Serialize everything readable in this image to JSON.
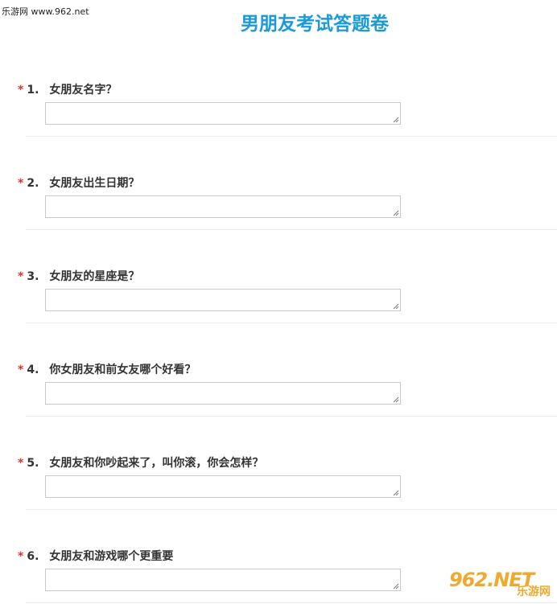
{
  "watermark": {
    "text": "乐游网 www.962.net"
  },
  "page": {
    "title": "男朋友考试答题卷"
  },
  "questions": [
    {
      "required": "*",
      "number": "1.",
      "text": "女朋友名字？",
      "answer": ""
    },
    {
      "required": "*",
      "number": "2.",
      "text": "女朋友出生日期？",
      "answer": ""
    },
    {
      "required": "*",
      "number": "3.",
      "text": "女朋友的星座是？",
      "answer": ""
    },
    {
      "required": "*",
      "number": "4.",
      "text": "你女朋友和前女友哪个好看？",
      "answer": ""
    },
    {
      "required": "*",
      "number": "5.",
      "text": "女朋友和你吵起来了，叫你滚，你会怎样？",
      "answer": ""
    },
    {
      "required": "*",
      "number": "6.",
      "text": "女朋友和游戏哪个更重要",
      "answer": ""
    }
  ],
  "logo": {
    "main": "962.NET",
    "sub": "乐游网"
  },
  "colors": {
    "title": "#1a9ad6",
    "required": "#e0322a",
    "logo": "#f0a92f"
  }
}
